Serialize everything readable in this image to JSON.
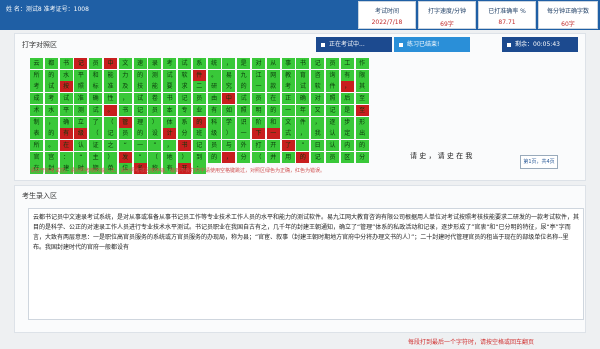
{
  "header": {
    "examinee": "姓 名：测试8  准考证号：1008",
    "stats": [
      {
        "label": "考试时间",
        "value": "2022/7/18"
      },
      {
        "label": "打字速度/分钟",
        "value": "69字"
      },
      {
        "label": "已打准确率 %",
        "value": "87.71"
      },
      {
        "label": "每分钟正确字数",
        "value": "60字"
      }
    ]
  },
  "typing_area": {
    "title": "打字对照区",
    "exam_button": "正在考试中...",
    "practice_button": "练习已结束!",
    "remaining": "剩余：00:05:43",
    "rows": [
      "云都书记员中文速录考试系统，是对从事书记员工作",
      "所的水平和能力的测试软件。易九江网教育咨询有限",
      "考试按照标准及技能要求二研究的一款考试软件，其",
      "成考试准确性，试卷书记员由中试员在正确对照后至",
      "术水平测试。书记员本专业有如照明的一年又记是至",
      "制，确立了（管理）体系的科学识阶和文件，逐步形",
      "表的有级（记员的设计分班级）一下一式，我认定出",
      "所。在认证之“一”，书记员与外打开了”日认内的",
      "官宫：“主）发”（地）到的，分（并用的记员区分",
      "在封建时期单位名称有开："
    ],
    "error_cells": [
      [
        0,
        3
      ],
      [
        0,
        5
      ],
      [
        1,
        11
      ],
      [
        2,
        2
      ],
      [
        2,
        21
      ],
      [
        3,
        13
      ],
      [
        3,
        24
      ],
      [
        4,
        5
      ],
      [
        4,
        22
      ],
      [
        5,
        6
      ],
      [
        5,
        11
      ],
      [
        5,
        23
      ],
      [
        5,
        29
      ],
      [
        5,
        30
      ],
      [
        6,
        2
      ],
      [
        6,
        3
      ],
      [
        6,
        9
      ],
      [
        6,
        15
      ],
      [
        6,
        16
      ],
      [
        6,
        29
      ],
      [
        7,
        2
      ],
      [
        7,
        10
      ],
      [
        7,
        17
      ],
      [
        7,
        23
      ],
      [
        7,
        30
      ],
      [
        8,
        6
      ],
      [
        8,
        13
      ],
      [
        8,
        18
      ],
      [
        8,
        24
      ],
      [
        8,
        27
      ],
      [
        9,
        7
      ],
      [
        9,
        10
      ],
      [
        9,
        15
      ]
    ],
    "tail_text": "请 史 ， 请 史 在 我",
    "pager": "第1页，共4页",
    "hint": "请在开始考试前，请对照考核的输入法，请对照考核后按序输，输到不会打的字请使用空格键跳过，对照区绿色为正确，红色为错误。"
  },
  "input_area": {
    "title": "考生录入区",
    "typed_text": "云都书记员中文速录考试系统，是对从事或准备从事书记员工作等专业技术工作人员的水平和能力的测试软件。易九江网大教育咨询有限公司根据用人单位对考试按照考核技能要求二研发的一款考试软件，其目的是科学、公正的对速录工作人员进行专业技术水平测试。书记员职业在我国自古有之，几千年的封建王朝通知，确立了“管理”体系的私政活动和记录，逐步形成了”官衷“和“已分明的特征，尿“亭”字而言，大致有两层意思：一是职位高官员服务的系统或方官员服务的办现局，称为县；“官宦、叙事（封建王朝时期地方官府中分将办理文书的人）”；二十封建时代管理官员的租当于现在的部级单位名称--里布。我国封建时代的官府一般都设有"
  },
  "footer": {
    "submit_hint": "每段打到最后一个字符时，请按空格或回车翻页"
  },
  "colors": {
    "header_bg": "#1f5fa5",
    "correct": "#39c839",
    "error": "#c81e1e"
  }
}
